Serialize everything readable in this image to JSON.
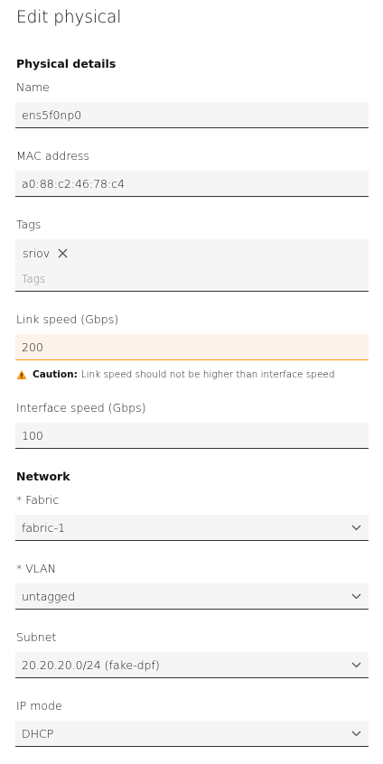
{
  "page": {
    "title": "Edit physical"
  },
  "physical_details": {
    "heading": "Physical details",
    "name": {
      "label": "Name",
      "value": "ens5f0np0"
    },
    "mac": {
      "label": "MAC address",
      "value": "a0:88:c2:46:78:c4"
    },
    "tags": {
      "label": "Tags",
      "chips": [
        "sriov"
      ],
      "placeholder": "Tags"
    },
    "link_speed": {
      "label": "Link speed (Gbps)",
      "value": "200",
      "caution_title": "Caution:",
      "caution_text": "Link speed should not be higher than interface speed",
      "warning_color": "#f99b11"
    },
    "interface_speed": {
      "label": "Interface speed (Gbps)",
      "value": "100"
    }
  },
  "network": {
    "heading": "Network",
    "fabric": {
      "label": "* Fabric",
      "value": "fabric-1"
    },
    "vlan": {
      "label": "* VLAN",
      "value": "untagged"
    },
    "subnet": {
      "label": "Subnet",
      "value": "20.20.20.0/24 (fake-dpf)"
    },
    "ip_mode": {
      "label": "IP mode",
      "value": "DHCP"
    }
  },
  "icons": {
    "chevron": "chevron-down-icon",
    "remove_tag": "close-icon",
    "caution": "warning-icon"
  }
}
